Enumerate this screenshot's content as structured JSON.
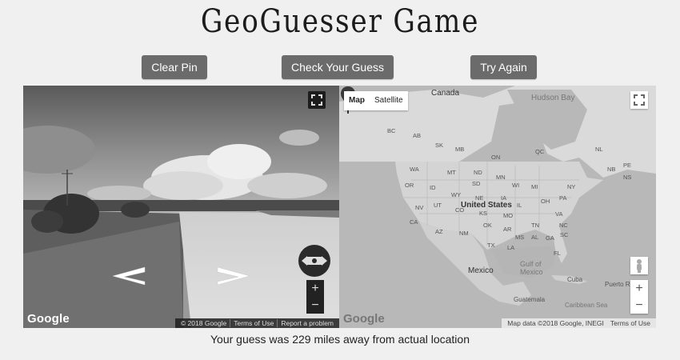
{
  "header": {
    "title": "GeoGuesser Game"
  },
  "toolbar": {
    "clear_label": "Clear Pin",
    "check_label": "Check Your Guess",
    "retry_label": "Try Again"
  },
  "streetview": {
    "logo": "Google",
    "footer": [
      "© 2018 Google",
      "Terms of Use",
      "Report a problem"
    ],
    "zoom_in": "+",
    "zoom_out": "−"
  },
  "map": {
    "type_options": [
      "Map",
      "Satellite"
    ],
    "selected_type": "Map",
    "logo": "Google",
    "footer": [
      "Map data ©2018 Google, INEGI",
      "Terms of Use"
    ],
    "zoom_in": "+",
    "zoom_out": "−",
    "labels": {
      "canada": "Canada",
      "hudson_bay": "Hudson Bay",
      "united_states": "United States",
      "gulf": "Gulf of Mexico",
      "mexico": "Mexico",
      "cuba": "Cuba",
      "puerto_rico": "Puerto R",
      "guatemala": "Guatemala",
      "caribbean": "Caribbean Sea",
      "states": [
        "BC",
        "AB",
        "SK",
        "MB",
        "ON",
        "QC",
        "NL",
        "WA",
        "MT",
        "ND",
        "MN",
        "OR",
        "ID",
        "SD",
        "WI",
        "MI",
        "NY",
        "WY",
        "NE",
        "IA",
        "PA",
        "NV",
        "UT",
        "CO",
        "KS",
        "MO",
        "IL",
        "OH",
        "VA",
        "CA",
        "OK",
        "TN",
        "NC",
        "AZ",
        "NM",
        "AR",
        "MS",
        "AL",
        "GA",
        "SC",
        "TX",
        "LA",
        "FL",
        "NB",
        "PE",
        "NS"
      ]
    }
  },
  "result": {
    "text": "Your guess was 229 miles away from actual location"
  }
}
